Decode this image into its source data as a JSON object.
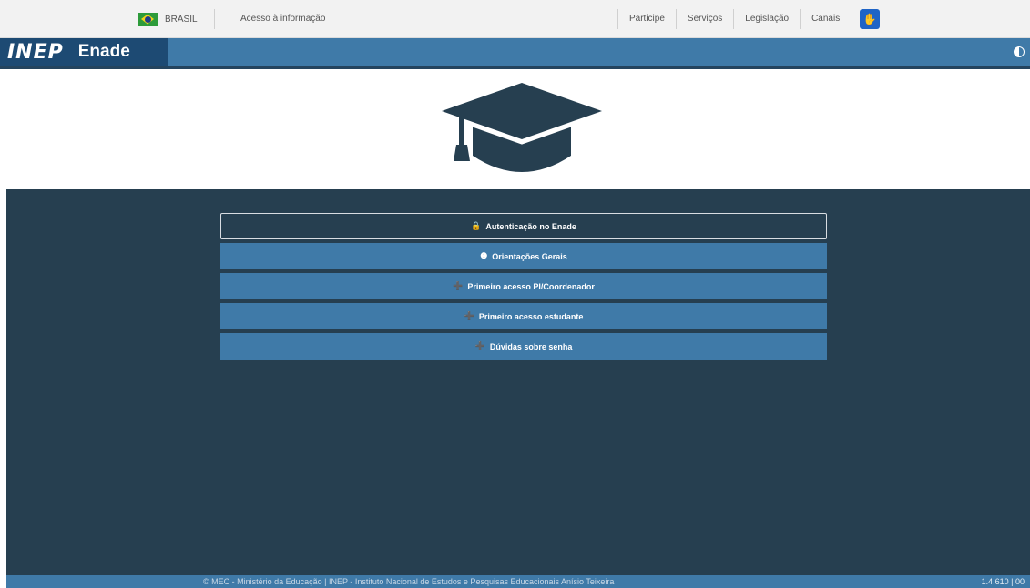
{
  "gov_bar": {
    "brasil": "BRASIL",
    "acesso": "Acesso à informação",
    "links": [
      "Participe",
      "Serviços",
      "Legislação",
      "Canais"
    ],
    "vlibras_icon": "vlibras-hand-icon"
  },
  "app_bar": {
    "logo": "INEP",
    "title": "Enade",
    "contrast_icon": "contrast-icon"
  },
  "hero": {
    "icon": "graduation-cap-icon",
    "color": "#263f50"
  },
  "menu": {
    "items": [
      {
        "icon": "🔒",
        "label": "Autenticação no Enade"
      },
      {
        "icon": "❶",
        "label": "Orientações Gerais"
      },
      {
        "icon": "➕",
        "label": "Primeiro acesso PI/Coordenador"
      },
      {
        "icon": "➕",
        "label": "Primeiro acesso estudante"
      },
      {
        "icon": "➕",
        "label": "Dúvidas sobre senha"
      }
    ]
  },
  "footer": {
    "text": "© MEC - Ministério da Educação | INEP - Instituto Nacional de Estudos e Pesquisas Educacionais Anísio Teixeira",
    "version": "1.4.610 | 00"
  },
  "colors": {
    "primary": "#3f7aa8",
    "dark": "#263f50",
    "logo_bg": "#1d4a73"
  }
}
